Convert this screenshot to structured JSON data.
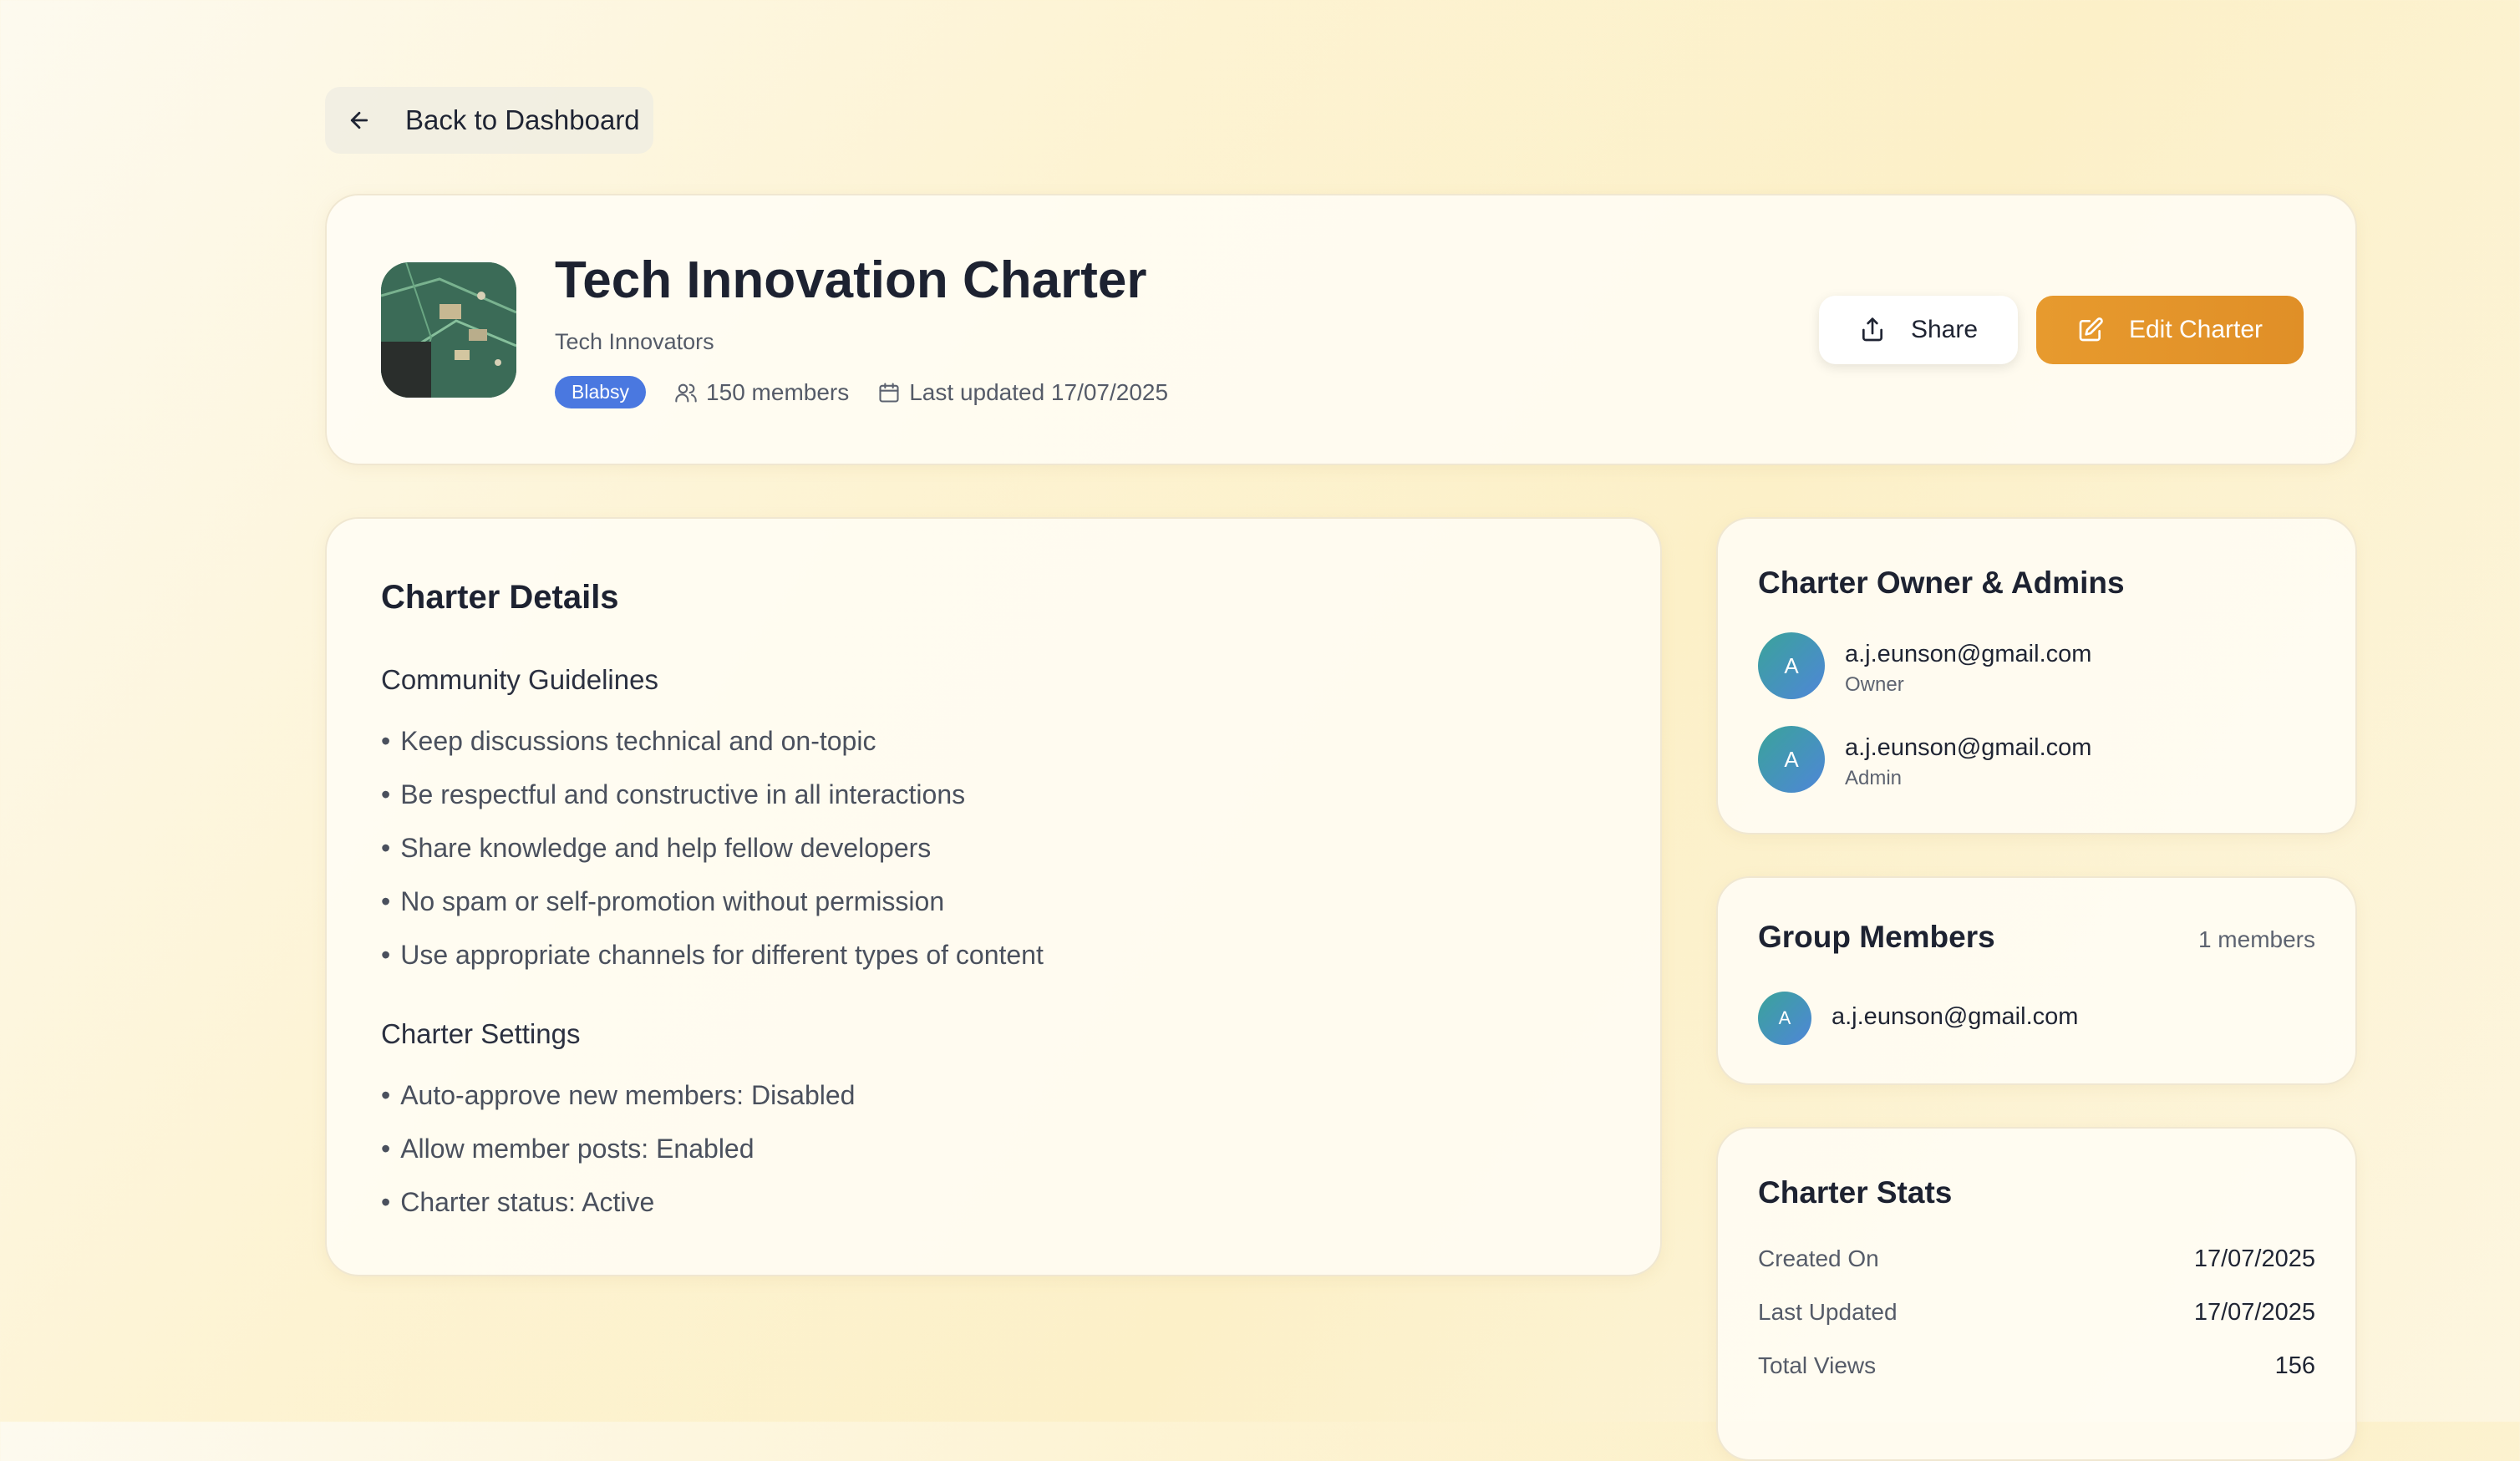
{
  "nav": {
    "back_label": "Back to Dashboard"
  },
  "charter": {
    "title": "Tech Innovation Charter",
    "organization": "Tech Innovators",
    "badge": "Blabsy",
    "members_text": "150 members",
    "last_updated_text": "Last updated 17/07/2025"
  },
  "actions": {
    "share_label": "Share",
    "edit_label": "Edit Charter"
  },
  "details": {
    "heading": "Charter Details",
    "guidelines_heading": "Community Guidelines",
    "guidelines": [
      "Keep discussions technical and on-topic",
      "Be respectful and constructive in all interactions",
      "Share knowledge and help fellow developers",
      "No spam or self-promotion without permission",
      "Use appropriate channels for different types of content"
    ],
    "settings_heading": "Charter Settings",
    "settings": [
      "Auto-approve new members: Disabled",
      "Allow member posts: Enabled",
      "Charter status: Active"
    ]
  },
  "admins": {
    "heading": "Charter Owner & Admins",
    "people": [
      {
        "initial": "A",
        "email": "a.j.eunson@gmail.com",
        "role": "Owner"
      },
      {
        "initial": "A",
        "email": "a.j.eunson@gmail.com",
        "role": "Admin"
      }
    ]
  },
  "members": {
    "heading": "Group Members",
    "count": "1 members",
    "people": [
      {
        "initial": "A",
        "email": "a.j.eunson@gmail.com"
      }
    ]
  },
  "stats": {
    "heading": "Charter Stats",
    "rows": [
      {
        "label": "Created On",
        "value": "17/07/2025"
      },
      {
        "label": "Last Updated",
        "value": "17/07/2025"
      },
      {
        "label": "Total Views",
        "value": "156"
      }
    ]
  },
  "colors": {
    "accent": "#e08f27",
    "badge": "#4a78e0"
  }
}
